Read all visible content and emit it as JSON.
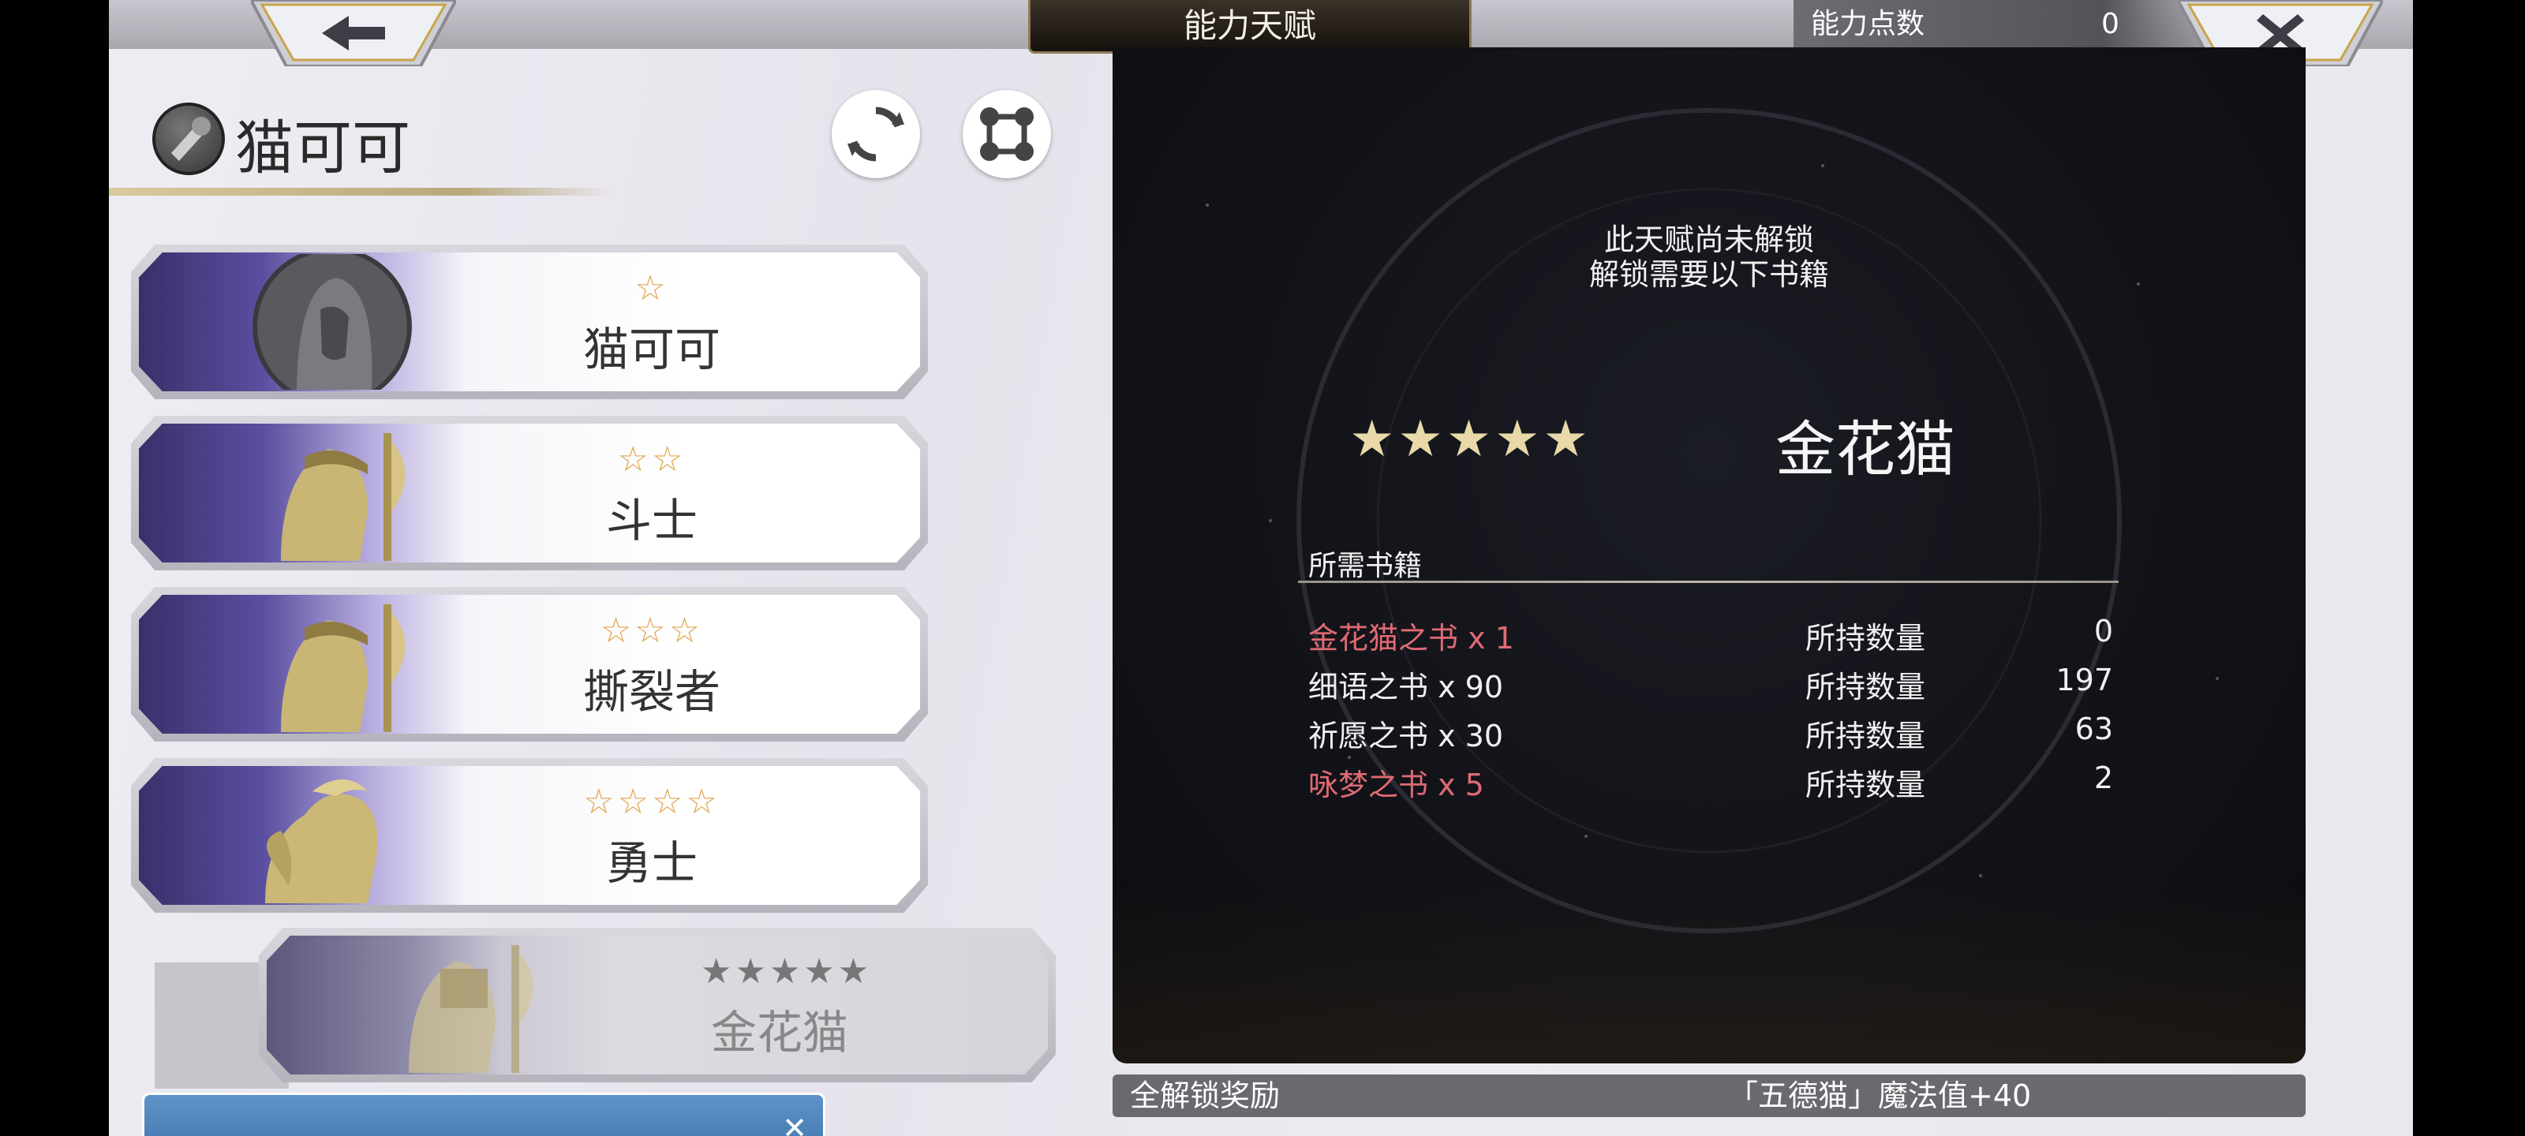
{
  "header": {
    "title": "能力天赋",
    "points_label": "能力点数",
    "points_value": "0"
  },
  "character": {
    "name": "猫可可",
    "refresh_icon": "refresh-icon",
    "node_icon": "node-graph-icon"
  },
  "classes": [
    {
      "stars": "☆",
      "name": "猫可可",
      "state": "unlocked"
    },
    {
      "stars": "☆☆",
      "name": "斗士",
      "state": "unlocked"
    },
    {
      "stars": "☆☆☆",
      "name": "撕裂者",
      "state": "unlocked"
    },
    {
      "stars": "☆☆☆☆",
      "name": "勇士",
      "state": "unlocked"
    },
    {
      "stars": "★★★★★",
      "name": "金花猫",
      "state": "locked"
    }
  ],
  "detail": {
    "lock_line1": "此天赋尚未解锁",
    "lock_line2": "解锁需要以下书籍",
    "stars": "★★★★★",
    "talent_name": "金花猫",
    "req_title": "所需书籍",
    "books": [
      {
        "name": "金花猫之书 x 1",
        "held_label": "所持数量",
        "held": "0",
        "short": true
      },
      {
        "name": "细语之书 x 90",
        "held_label": "所持数量",
        "held": "197",
        "short": false
      },
      {
        "name": "祈愿之书 x 30",
        "held_label": "所持数量",
        "held": "63",
        "short": false
      },
      {
        "name": "咏梦之书 x 5",
        "held_label": "所持数量",
        "held": "2",
        "short": true
      }
    ]
  },
  "reward": {
    "label": "全解锁奖励",
    "value": "「五德猫」魔法值+40"
  },
  "colors": {
    "accent_gold": "#e2a64e",
    "shortage_red": "#e06a74",
    "panel_dark": "#121318"
  }
}
